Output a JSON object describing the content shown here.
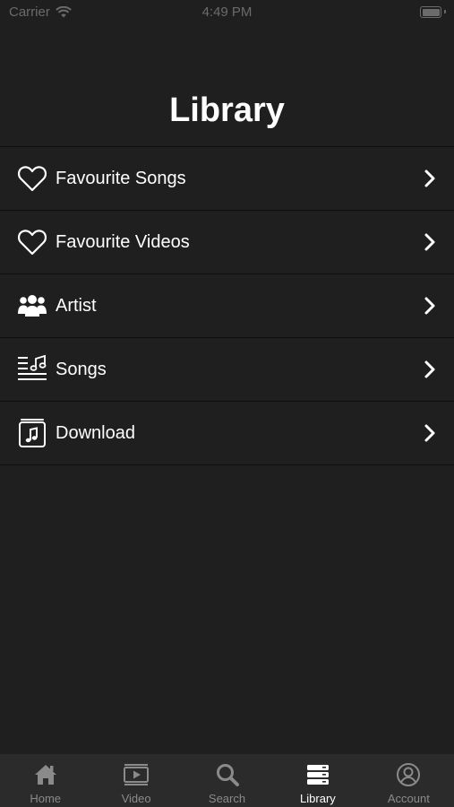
{
  "status_bar": {
    "carrier": "Carrier",
    "time": "4:49 PM"
  },
  "page": {
    "title": "Library"
  },
  "menu": {
    "items": [
      {
        "label": "Favourite Songs",
        "icon": "heart-icon"
      },
      {
        "label": "Favourite Videos",
        "icon": "heart-icon"
      },
      {
        "label": "Artist",
        "icon": "people-icon"
      },
      {
        "label": "Songs",
        "icon": "music-list-icon"
      },
      {
        "label": "Download",
        "icon": "music-file-icon"
      }
    ]
  },
  "tab_bar": {
    "active": "Library",
    "tabs": [
      {
        "label": "Home",
        "icon": "home-icon"
      },
      {
        "label": "Video",
        "icon": "video-icon"
      },
      {
        "label": "Search",
        "icon": "search-icon"
      },
      {
        "label": "Library",
        "icon": "library-icon"
      },
      {
        "label": "Account",
        "icon": "account-icon"
      }
    ]
  },
  "colors": {
    "background": "#1f1f1f",
    "tab_bar": "#2b2b2b",
    "tab_inactive": "#8a8a8a",
    "tab_active": "#ffffff",
    "separator": "#0e0e0e"
  }
}
